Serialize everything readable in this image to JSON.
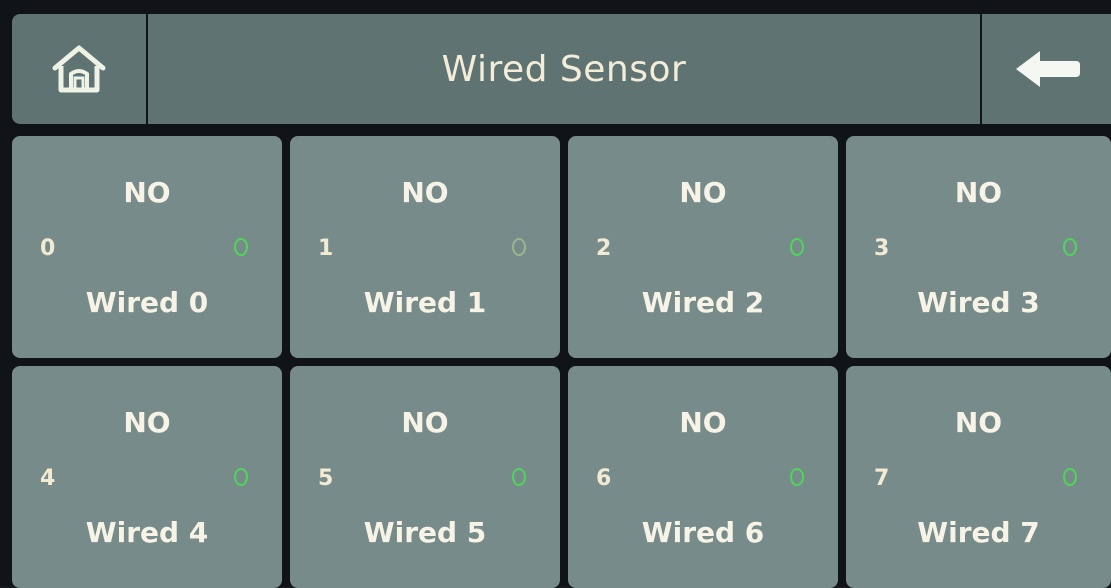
{
  "header": {
    "title": "Wired Sensor",
    "home_icon": "home-icon",
    "back_icon": "back-arrow-icon"
  },
  "colors": {
    "panel": "#5f7373",
    "tile": "#778c8a",
    "indicator": "#4fd65a",
    "text": "#f7f3e6"
  },
  "sensors": [
    {
      "index": "0",
      "status": "NO",
      "name": "Wired 0"
    },
    {
      "index": "1",
      "status": "NO",
      "name": "Wired 1"
    },
    {
      "index": "2",
      "status": "NO",
      "name": "Wired 2"
    },
    {
      "index": "3",
      "status": "NO",
      "name": "Wired 3"
    },
    {
      "index": "4",
      "status": "NO",
      "name": "Wired 4"
    },
    {
      "index": "5",
      "status": "NO",
      "name": "Wired 5"
    },
    {
      "index": "6",
      "status": "NO",
      "name": "Wired 6"
    },
    {
      "index": "7",
      "status": "NO",
      "name": "Wired 7"
    }
  ]
}
